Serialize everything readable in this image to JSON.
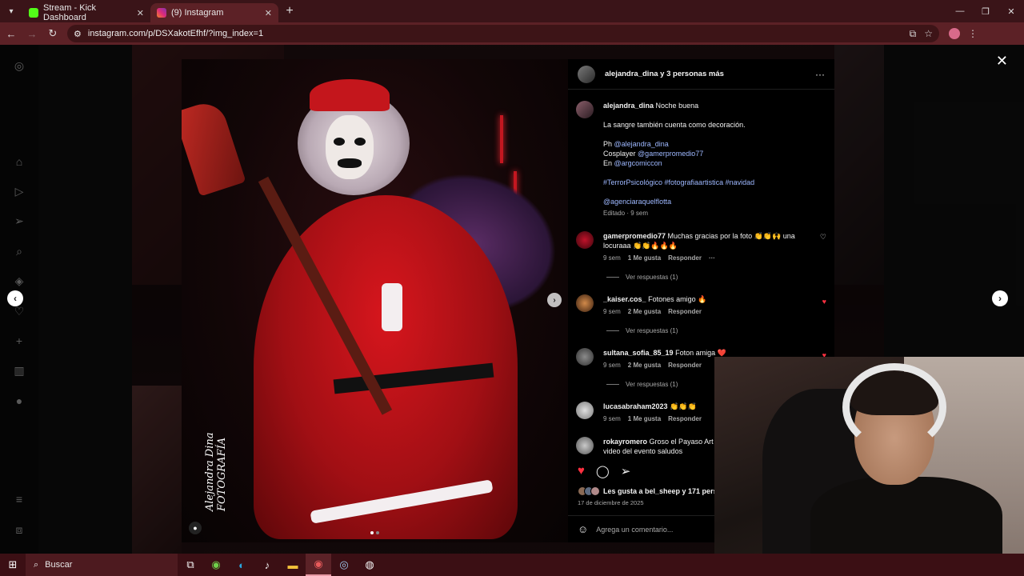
{
  "browser": {
    "tabs": [
      {
        "label": "Stream - Kick Dashboard",
        "favicon_color": "#53fc18"
      },
      {
        "label": "(9) Instagram",
        "favicon_color": "#e1306c"
      }
    ],
    "url": "instagram.com/p/DSXakotEfhf/?img_index=1",
    "new_tab": "+",
    "window_controls": [
      "—",
      "❐",
      "✕"
    ]
  },
  "post": {
    "header_user": "alejandra_dina y 3 personas más",
    "watermark": "Alejandra Dina FOTOGRAFÍA",
    "caption": {
      "user": "alejandra_dina",
      "title": "Noche buena",
      "line1": "La sangre también cuenta como decoración.",
      "ph_label": "Ph",
      "ph_link": "@alejandra_dina",
      "cosplayer_label": "Cosplayer",
      "cosplayer_link": "@gamerpromedio77",
      "en_label": "En",
      "en_link": "@argcomiccon",
      "hashtags": "#TerrorPsicológico #fotografiaartistica #navidad",
      "agency": "@agenciaraquelflotta",
      "edited": "Editado · 9 sem"
    },
    "comments": [
      {
        "user": "gamerpromedio77",
        "text": "Muchas gracias por la foto 👏👏🙌 una locuraaa 👏👏🔥🔥🔥",
        "time": "9 sem",
        "likes": "1 Me gusta",
        "reply": "Responder",
        "more": "···",
        "view_replies": "Ver respuestas (1)",
        "liked": false
      },
      {
        "user": "_kaiser.cos_",
        "text": "Fotones amigo 🔥",
        "time": "9 sem",
        "likes": "2 Me gusta",
        "reply": "Responder",
        "view_replies": "Ver respuestas (1)",
        "liked": true
      },
      {
        "user": "sultana_sofia_85_19",
        "text": "Foton amiga ❤️",
        "time": "9 sem",
        "likes": "2 Me gusta",
        "reply": "Responder",
        "view_replies": "Ver respuestas (1)",
        "liked": true
      },
      {
        "user": "lucasabraham2023",
        "text": "👏👏👏",
        "time": "9 sem",
        "likes": "1 Me gusta",
        "reply": "Responder",
        "liked": false
      },
      {
        "user": "rokayromero",
        "text": "Groso el Payaso Art video del evento saludos",
        "liked": false
      }
    ],
    "likes_text": "Les gusta a bel_sheep y 171 perso",
    "date": "17 de diciembre de 2025",
    "add_comment_placeholder": "Agrega un comentario..."
  },
  "taskbar": {
    "search_label": "Buscar"
  },
  "colors": {
    "chrome_tabs": "#3a1418",
    "chrome_bar": "#5c2126",
    "link": "#9eb8ff",
    "like_red": "#ff3040"
  }
}
